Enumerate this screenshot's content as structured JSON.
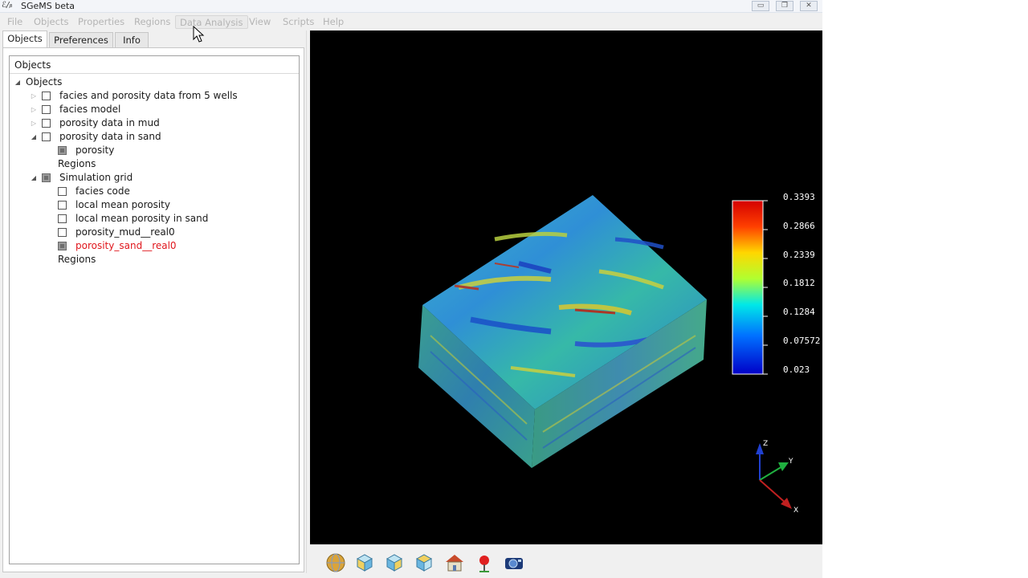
{
  "window": {
    "title": "SGeMS beta",
    "controls": {
      "minimize": "▭",
      "maximize": "❐",
      "close": "✕"
    }
  },
  "menu": {
    "items": [
      "File",
      "Objects",
      "Properties",
      "Regions",
      "Data Analysis",
      "View",
      "Scripts",
      "Help"
    ]
  },
  "tabs": [
    "Objects",
    "Preferences",
    "Info"
  ],
  "tree": {
    "header": "Objects",
    "root": "Objects",
    "items": [
      "facies and porosity data from 5 wells",
      "facies model",
      "porosity data in mud",
      "porosity data in sand",
      "porosity",
      "Regions",
      "Simulation grid",
      "facies code",
      "local mean porosity",
      "local mean porosity in sand",
      "porosity_mud__real0",
      "porosity_sand__real0",
      "Regions"
    ]
  },
  "colorbar": {
    "labels": [
      "0.3393",
      "0.2866",
      "0.2339",
      "0.1812",
      "0.1284",
      "0.07572",
      "0.023"
    ]
  },
  "axes": {
    "z": "Z",
    "y": "Y",
    "x": "X"
  },
  "colors": {
    "selected_property": "#e0161c",
    "viewport_bg": "#000000"
  },
  "toolbar_icons": [
    "globe-icon",
    "cube-icon",
    "cube-icon",
    "cube-icon",
    "home-icon",
    "pin-icon",
    "camera-icon"
  ]
}
